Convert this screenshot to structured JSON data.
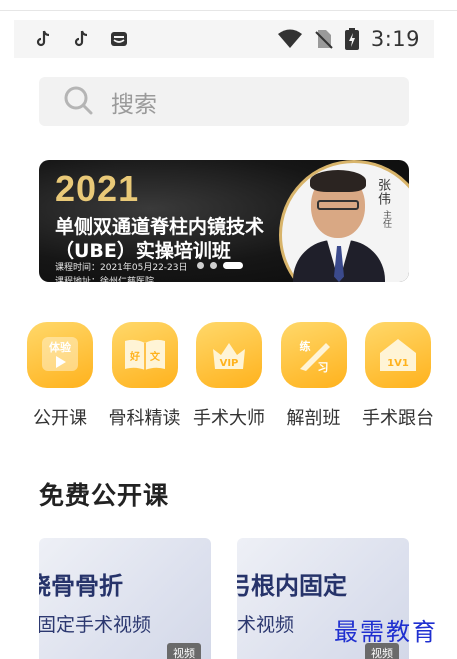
{
  "status_bar": {
    "left_icons": [
      "tiktok-icon",
      "tiktok-icon",
      "message-icon"
    ],
    "right_icons": [
      "wifi-icon",
      "no-sim-icon",
      "battery-charging-icon"
    ],
    "time": "3:19"
  },
  "search": {
    "icon": "search-icon",
    "placeholder": "搜索"
  },
  "banner": {
    "year": "2021",
    "title_line1": "单侧双通道脊柱内镜技术",
    "title_line2": "（UBE）实操培训班",
    "date_line": "课程时间：2021年05月22-23日",
    "address_line": "课程地址：徐州仁慈医院",
    "speaker_name": "张伟",
    "speaker_title": "主任",
    "slide_count": 3,
    "active_slide": 3
  },
  "categories": [
    {
      "label": "公开课",
      "icon": "trial-play-icon",
      "icon_text": "体验"
    },
    {
      "label": "骨科精读",
      "icon": "book-icon",
      "icon_text": "好文"
    },
    {
      "label": "手术大师",
      "icon": "crown-vip-icon",
      "icon_text": "VIP"
    },
    {
      "label": "解剖班",
      "icon": "scalpel-icon",
      "icon_text": "练习"
    },
    {
      "label": "手术跟台",
      "icon": "house-1v1-icon",
      "icon_text": "1V1"
    }
  ],
  "section": {
    "title": "免费公开课"
  },
  "cards": [
    {
      "title": "桡骨骨折",
      "subtitle": "固定手术视频",
      "tag": "视频"
    },
    {
      "title": "弓根内固定",
      "subtitle": "术视频",
      "tag": "视频"
    }
  ],
  "watermark": "最需教育",
  "colors": {
    "accent_yellow": "#ffb21d",
    "banner_gold": "#e9c978",
    "card_title": "#26336a",
    "watermark": "#1f2fd0"
  }
}
